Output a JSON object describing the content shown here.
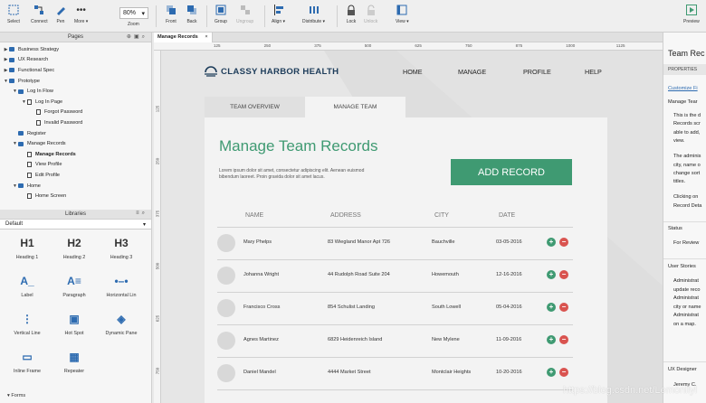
{
  "toolbar": {
    "select": "Select",
    "connect": "Connect",
    "pen": "Pen",
    "more": "More ▾",
    "zoom": "80%",
    "zoom_label": "Zoom",
    "front": "Front",
    "back": "Back",
    "group": "Group",
    "ungroup": "Ungroup",
    "align": "Align ▾",
    "distribute": "Distribute ▾",
    "lock": "Lock",
    "unlock": "Unlock",
    "view": "View ▾",
    "preview": "Preview"
  },
  "pages": {
    "title": "Pages",
    "items": [
      {
        "label": "Business Strategy",
        "level": 0,
        "type": "folder",
        "tw": "▶"
      },
      {
        "label": "UX Research",
        "level": 0,
        "type": "folder",
        "tw": "▶"
      },
      {
        "label": "Functional Spec",
        "level": 0,
        "type": "folder",
        "tw": "▶"
      },
      {
        "label": "Prototype",
        "level": 0,
        "type": "folder",
        "tw": "▼"
      },
      {
        "label": "Log In Flow",
        "level": 1,
        "type": "folder",
        "tw": "▼"
      },
      {
        "label": "Log In Page",
        "level": 2,
        "type": "page",
        "tw": "▼"
      },
      {
        "label": "Forgot Password",
        "level": 3,
        "type": "page",
        "tw": ""
      },
      {
        "label": "Invalid Password",
        "level": 3,
        "type": "page",
        "tw": ""
      },
      {
        "label": "Register",
        "level": 1,
        "type": "folder",
        "tw": ""
      },
      {
        "label": "Manage Records",
        "level": 1,
        "type": "folder",
        "tw": "▼"
      },
      {
        "label": "Manage Records",
        "level": 2,
        "type": "page",
        "tw": "",
        "bold": true
      },
      {
        "label": "View Profile",
        "level": 2,
        "type": "page",
        "tw": ""
      },
      {
        "label": "Edit Profile",
        "level": 2,
        "type": "page",
        "tw": ""
      },
      {
        "label": "Home",
        "level": 1,
        "type": "folder",
        "tw": "▼"
      },
      {
        "label": "Home Screen",
        "level": 2,
        "type": "page",
        "tw": ""
      }
    ]
  },
  "libraries": {
    "title": "Libraries",
    "selected": "Default",
    "widgets": [
      {
        "glyph": "H1",
        "label": "Heading 1"
      },
      {
        "glyph": "H2",
        "label": "Heading 2"
      },
      {
        "glyph": "H3",
        "label": "Heading 3"
      },
      {
        "glyph": "A_",
        "label": "Label"
      },
      {
        "glyph": "A≡",
        "label": "Paragraph"
      },
      {
        "glyph": "•–•",
        "label": "Horizontal Lin"
      },
      {
        "glyph": "⋮",
        "label": "Vertical Line"
      },
      {
        "glyph": "▣",
        "label": "Hot Spot"
      },
      {
        "glyph": "◈",
        "label": "Dynamic Pane"
      },
      {
        "glyph": "▭",
        "label": "Inline Frame"
      },
      {
        "glyph": "▦",
        "label": "Repeater"
      }
    ],
    "section": "Forms"
  },
  "tab": {
    "label": "Manage Records",
    "close": "×"
  },
  "ruler": {
    "h": [
      "125",
      "250",
      "375",
      "500",
      "625",
      "750",
      "875",
      "1000",
      "1125"
    ],
    "v": [
      "125",
      "250",
      "375",
      "500",
      "625",
      "750"
    ]
  },
  "site": {
    "brand": "CLASSY HARBOR HEALTH",
    "nav": [
      "HOME",
      "MANAGE",
      "PROFILE",
      "HELP"
    ],
    "tabs": [
      "TEAM OVERVIEW",
      "MANAGE TEAM"
    ],
    "title": "Manage Team Records",
    "desc": "Lorem ipsum dolor sit amet, consectetur adipiscing elit. Aenean euismod bibendum laoreet. Proin gravida dolor sit amet lacus.",
    "add": "ADD RECORD",
    "cols": [
      "NAME",
      "ADDRESS",
      "CITY",
      "DATE"
    ],
    "rows": [
      [
        "Mary Phelps",
        "83 Wiegland Manor Apt 726",
        "Bauchville",
        "03-05-2016"
      ],
      [
        "Johanna Wright",
        "44 Rudolph Road Suite 204",
        "Howemouth",
        "12-16-2016"
      ],
      [
        "Francisco Cross",
        "854 Schulist Landing",
        "South Lowell",
        "05-04-2016"
      ],
      [
        "Agnes Martinez",
        "6829 Heidenreich Island",
        "New Mylene",
        "11-09-2016"
      ],
      [
        "Daniel Mandel",
        "4444 Market Street",
        "Montclair Heights",
        "10-20-2016"
      ]
    ],
    "plus": "+",
    "minus": "−"
  },
  "right": {
    "title": "Team Rec",
    "props": "PROPERTIES",
    "customize": "Customize Fi",
    "manage": "Manage Tear",
    "desc1": [
      "This is the d",
      "Records scr",
      "able to add,",
      "view."
    ],
    "desc2": [
      "The adminis",
      "city, name o",
      "change sort",
      "titles."
    ],
    "desc3": [
      "Clicking on",
      "Record Deta"
    ],
    "status": "Status",
    "status_val": "For Review",
    "stories": "User Stories",
    "stories_lines": [
      "Administrat",
      "update reco",
      "Administrat",
      "city or name",
      "Administrat",
      "on a map."
    ],
    "designer": "UX Designer",
    "designer_val": "Jeremy C."
  },
  "watermark": "https://blog.csdn.net/Lemonllyl"
}
